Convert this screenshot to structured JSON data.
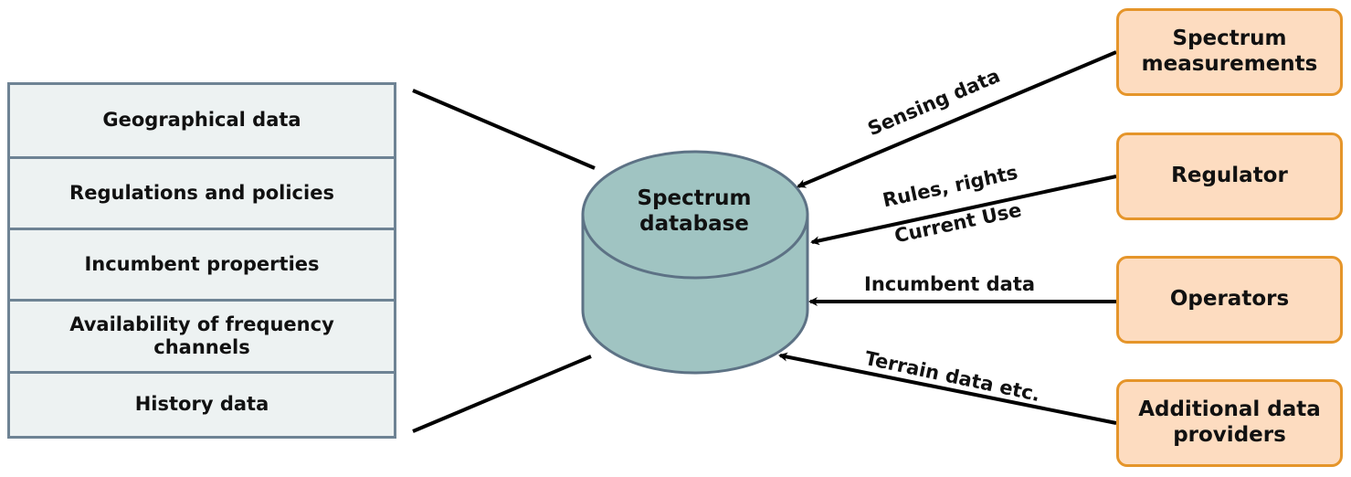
{
  "diagram": {
    "data_categories": [
      {
        "label": "Geographical data"
      },
      {
        "label": "Regulations and policies"
      },
      {
        "label": "Incumbent properties"
      },
      {
        "label": "Availability of frequency channels"
      },
      {
        "label": "History data"
      }
    ],
    "database": {
      "label": "Spectrum database"
    },
    "sources": [
      {
        "label": "Spectrum measurements",
        "edge_label": "Sensing data"
      },
      {
        "label": "Regulator",
        "edge_label": "Rules, rights",
        "edge_label_2": "Current Use"
      },
      {
        "label": "Operators",
        "edge_label": "Incumbent data"
      },
      {
        "label": "Additional data providers",
        "edge_label": "Terrain data etc."
      }
    ],
    "colors": {
      "stack_fill": "#edf2f2",
      "stack_border": "#6e8394",
      "database_fill": "#a0c4c2",
      "database_stroke": "#5d7285",
      "source_fill": "#fddcc0",
      "source_border": "#e5952a",
      "arrow": "#000000"
    }
  }
}
